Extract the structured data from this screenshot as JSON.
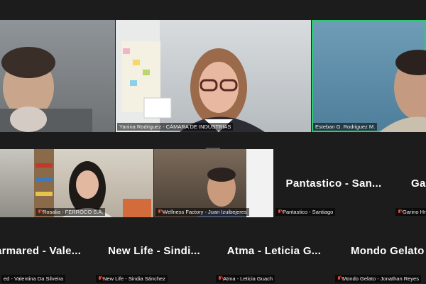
{
  "participants": {
    "row1": [
      {
        "name": ""
      },
      {
        "name": "Yanina Rodriguez - CÁMARA DE INDUSTRIAS"
      },
      {
        "name": "Esteban G. Rodriguez M."
      }
    ],
    "row2": [
      {
        "name": ""
      },
      {
        "name": "Rosalia - FERROCO S.A."
      },
      {
        "name": "Wellness Factory - Juan Izuibejeres"
      },
      {
        "placeholder": "Pantastico - San...",
        "name": "Pantastico - Santiago"
      },
      {
        "placeholder": "Gar",
        "name": "Garino Hn"
      }
    ],
    "row3": [
      {
        "placeholder": "armared - Vale...",
        "name": "ed - Valentina Da Silveira"
      },
      {
        "placeholder": "New Life - Sindi...",
        "name": "New Life - Sindia Sánchez"
      },
      {
        "placeholder": "Atma - Leticia G...",
        "name": "Atma - Leticia Guach"
      },
      {
        "placeholder": "Mondo Gelato - ...",
        "name": "Mondo Gelato - Jonathan Reyes"
      }
    ]
  },
  "colors": {
    "active_speaker": "#2ecc71",
    "muted_icon": "#e5483d"
  }
}
